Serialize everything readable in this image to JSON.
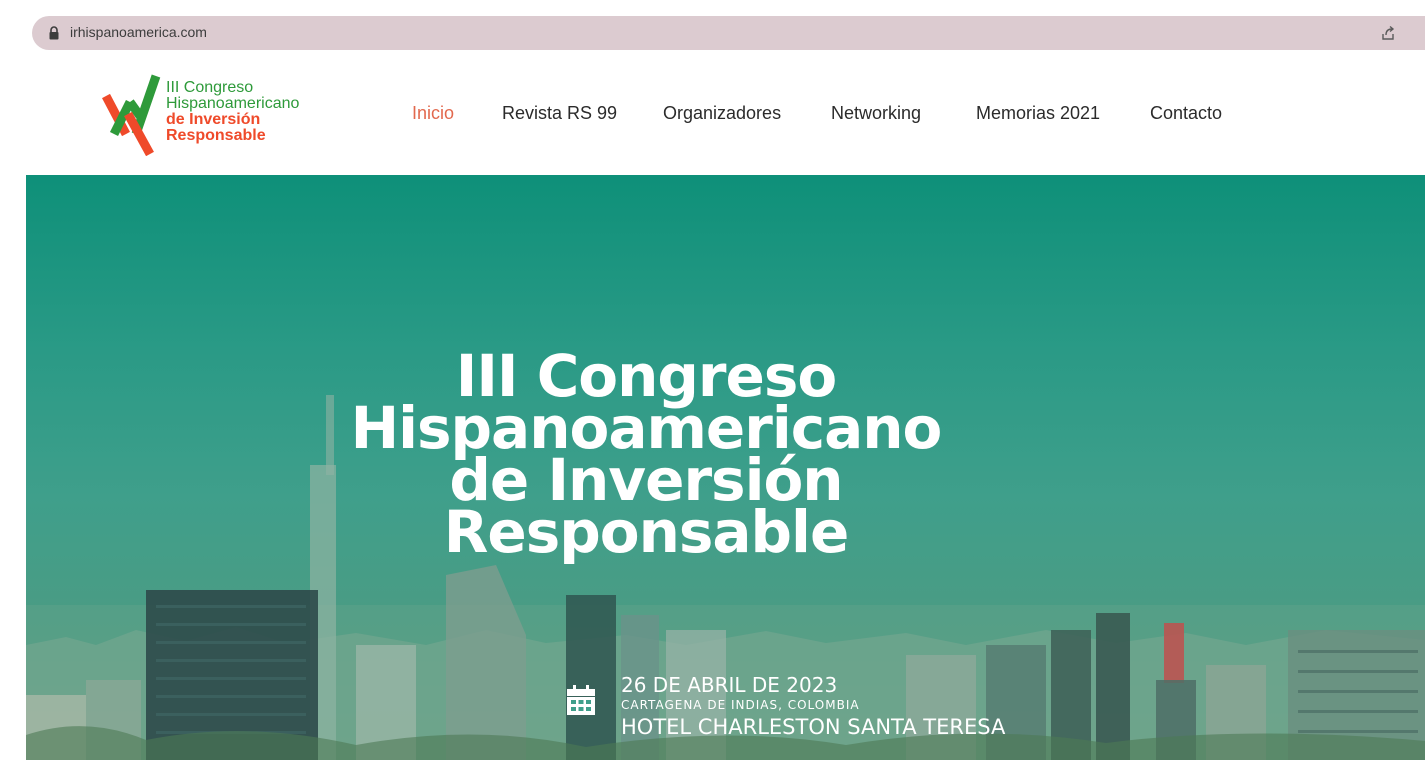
{
  "browser": {
    "url": "irhispanoamerica.com"
  },
  "logo": {
    "line1": "III Congreso",
    "line2": "Hispanoamericano",
    "line3": "de Inversión",
    "line4": "Responsable",
    "colors": {
      "green": "#2e9a3a",
      "orange": "#ef4a2a"
    }
  },
  "nav": {
    "items": [
      {
        "label": "Inicio",
        "active": true
      },
      {
        "label": "Revista RS 99",
        "active": false
      },
      {
        "label": "Organizadores",
        "active": false
      },
      {
        "label": "Networking",
        "active": false
      },
      {
        "label": "Memorias 2021",
        "active": false
      },
      {
        "label": "Contacto",
        "active": false
      }
    ],
    "active_color": "#e2694e"
  },
  "hero": {
    "title_lines": [
      "III Congreso",
      "Hispanoamericano",
      "de Inversión",
      "Responsable"
    ],
    "date": "26 DE ABRIL DE 2023",
    "city": "CARTAGENA DE INDIAS, COLOMBIA",
    "venue": "HOTEL CHARLESTON SANTA TERESA",
    "overlay_color": "#0e9079"
  }
}
